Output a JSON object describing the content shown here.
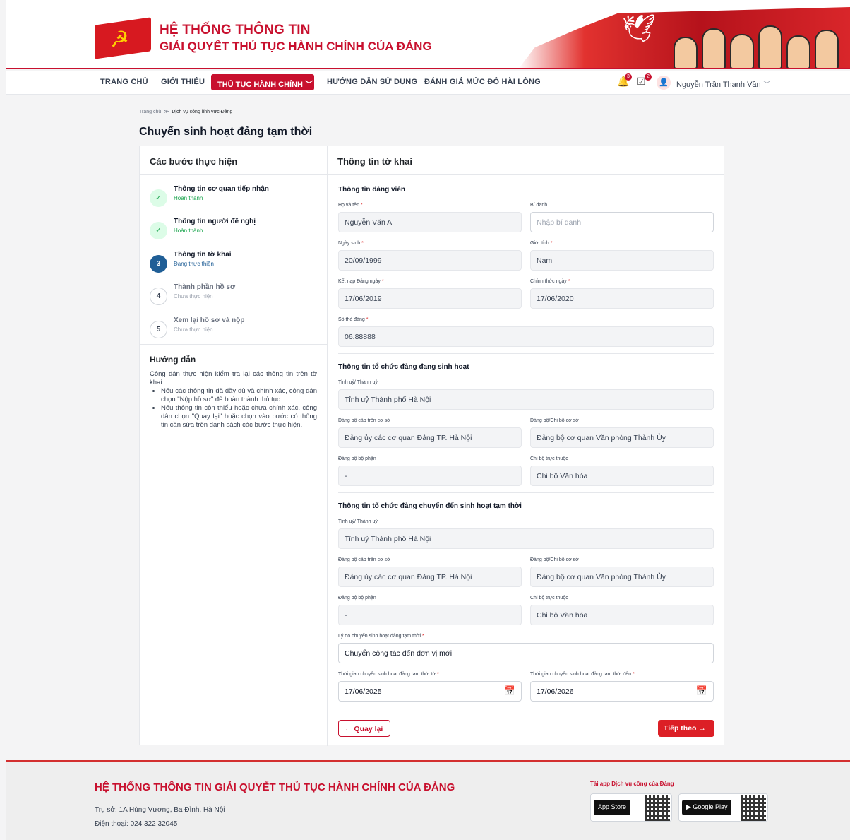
{
  "header": {
    "line1": "HỆ THỐNG THÔNG TIN",
    "line2": "GIẢI QUYẾT THỦ TỤC HÀNH CHÍNH CỦA ĐẢNG"
  },
  "nav": {
    "items": [
      "TRANG CHỦ",
      "GIỚI THIỆU",
      "THỦ TỤC HÀNH CHÍNH",
      "HƯỚNG DẪN SỬ DỤNG",
      "ĐÁNH GIÁ MỨC ĐỘ HÀI LÒNG"
    ],
    "notif_count": "3",
    "task_count": "2",
    "username": "Nguyễn Trần Thanh Vân"
  },
  "breadcrumb": {
    "home": "Trang chủ",
    "sep": "≫",
    "current": "Dịch vụ công lĩnh vực Đảng"
  },
  "page_title": "Chuyển sinh hoạt đảng tạm thời",
  "steps": {
    "heading": "Các bước thực hiện",
    "items": [
      {
        "num": "✓",
        "title": "Thông tin cơ quan tiếp nhận",
        "status": "Hoàn thành",
        "color": "#16a34a"
      },
      {
        "num": "✓",
        "title": "Thông tin người đề nghị",
        "status": "Hoàn thành",
        "color": "#16a34a"
      },
      {
        "num": "3",
        "title": "Thông tin tờ khai",
        "status": "Đang thực thiện",
        "color": "#1f5e96"
      },
      {
        "num": "4",
        "title": "Thành phần hồ sơ",
        "status": "Chưa thực hiện",
        "color": "#9ca3af"
      },
      {
        "num": "5",
        "title": "Xem lại hồ sơ và nộp",
        "status": "Chưa thực hiện",
        "color": "#9ca3af"
      }
    ]
  },
  "guide": {
    "heading": "Hướng dẫn",
    "intro": "Công dân thực hiện kiểm tra lại các thông tin trên tờ khai.",
    "bullets": [
      "Nếu các thông tin đã đầy đủ và chính xác, công dân chọn \"Nộp hồ sơ\" để hoàn thành thủ tục.",
      "Nếu thông tin còn thiếu hoặc chưa chính xác, công dân chọn \"Quay lại\" hoặc chọn vào bước có thông tin cần sửa trên danh sách các bước thực hiện."
    ]
  },
  "form": {
    "heading": "Thông tin tờ khai",
    "s1": "Thông tin đảng viên",
    "ho_ten": {
      "label": "Họ và tên",
      "value": "Nguyễn Văn A"
    },
    "bi_danh": {
      "label": "Bí danh",
      "placeholder": "Nhập bí danh"
    },
    "ngay_sinh": {
      "label": "Ngày sinh",
      "value": "20/09/1999"
    },
    "gioi_tinh": {
      "label": "Giới tính",
      "value": "Nam"
    },
    "ket_nap": {
      "label": "Kết nạp Đảng ngày",
      "value": "17/06/2019"
    },
    "chinh_thuc": {
      "label": "Chính thức ngày",
      "value": "17/06/2020"
    },
    "so_the": {
      "label": "Số thẻ đảng",
      "value": "06.88888"
    },
    "s2": "Thông tin tổ chức đảng đang sinh hoạt",
    "a_tinh": {
      "label": "Tỉnh uỷ/ Thành uỷ",
      "value": "Tỉnh uỷ Thành phố Hà Nội"
    },
    "a_cap_tren": {
      "label": "Đảng bộ cấp trên cơ sở",
      "value": "Đảng ủy các cơ quan Đảng TP. Hà Nội"
    },
    "a_co_so": {
      "label": "Đảng bộ/Chi bộ cơ sở",
      "value": "Đảng bộ cơ quan Văn phòng Thành Ủy"
    },
    "a_bo_phan": {
      "label": "Đảng bộ bộ phận",
      "value": "-"
    },
    "a_chi_bo": {
      "label": "Chi bộ trực thuộc",
      "value": "Chi bộ Văn hóa"
    },
    "s3": "Thông tin tổ chức đảng chuyển đến sinh hoạt tạm thời",
    "b_tinh": {
      "label": "Tỉnh uỷ/ Thành uỷ",
      "value": "Tỉnh uỷ Thành phố Hà Nội"
    },
    "b_cap_tren": {
      "label": "Đảng bộ cấp trên cơ sở",
      "value": "Đảng ủy các cơ quan Đảng TP. Hà Nội"
    },
    "b_co_so": {
      "label": "Đảng bộ/Chi bộ cơ sở",
      "value": "Đảng bộ cơ quan Văn phòng Thành Ủy"
    },
    "b_bo_phan": {
      "label": "Đảng bộ bộ phận",
      "value": "-"
    },
    "b_chi_bo": {
      "label": "Chi bộ trực thuộc",
      "value": "Chi bộ Văn hóa"
    },
    "ly_do": {
      "label": "Lý do chuyển sinh hoạt đảng tạm thời",
      "value": "Chuyển công tác đến đơn vị mới"
    },
    "tu_ngay": {
      "label": "Thời gian chuyển sinh hoạt đảng tạm thời từ",
      "value": "17/06/2025"
    },
    "den_ngay": {
      "label": "Thời gian chuyển sinh hoạt đảng tạm thời đến",
      "value": "17/06/2026"
    },
    "back": "← Quay lại",
    "next": "Tiếp theo →"
  },
  "footer": {
    "title": "HỆ THỐNG THÔNG TIN GIẢI QUYẾT THỦ TỤC HÀNH CHÍNH CỦA ĐẢNG",
    "address": "Trụ sở: 1A Hùng Vương, Ba Đình, Hà Nội",
    "phone": "Điện thoại: 024 322 32045",
    "app_title": "Tải app Dịch vụ công của Đảng",
    "app_store": " App Store",
    "google_play": "▶ Google Play"
  },
  "colors": {
    "brand": "#c8102e",
    "active_step": "#1f5e96",
    "done": "#16a34a"
  }
}
